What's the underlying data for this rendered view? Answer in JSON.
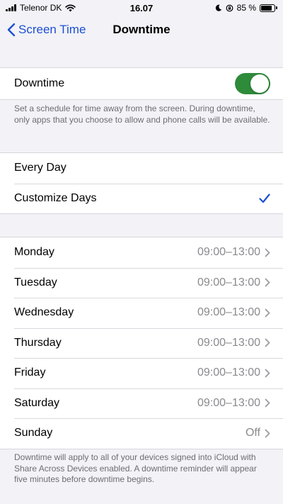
{
  "status": {
    "carrier": "Telenor DK",
    "time": "16.07",
    "battery": "85 %",
    "battery_level": 0.85
  },
  "nav": {
    "back_label": "Screen Time",
    "title": "Downtime"
  },
  "downtime": {
    "label": "Downtime",
    "enabled": true,
    "description": "Set a schedule for time away from the screen. During downtime, only apps that you choose to allow and phone calls will be available."
  },
  "schedule_options": [
    {
      "label": "Every Day",
      "selected": false
    },
    {
      "label": "Customize Days",
      "selected": true
    }
  ],
  "days": [
    {
      "day": "Monday",
      "time": "09:00–13:00"
    },
    {
      "day": "Tuesday",
      "time": "09:00–13:00"
    },
    {
      "day": "Wednesday",
      "time": "09:00–13:00"
    },
    {
      "day": "Thursday",
      "time": "09:00–13:00"
    },
    {
      "day": "Friday",
      "time": "09:00–13:00"
    },
    {
      "day": "Saturday",
      "time": "09:00–13:00"
    },
    {
      "day": "Sunday",
      "time": "Off"
    }
  ],
  "footer": "Downtime will apply to all of your devices signed into iCloud with Share Across Devices enabled. A downtime reminder will appear five minutes before downtime begins.",
  "colors": {
    "accent": "#1d4fd1",
    "toggle_on": "#2e8b3a",
    "secondary_text": "#8a8a8e"
  }
}
